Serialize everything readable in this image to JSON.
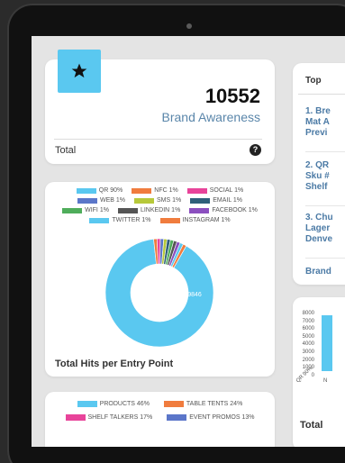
{
  "brand": {
    "value": "10552",
    "label": "Brand Awareness",
    "total_label": "Total",
    "help_glyph": "?",
    "accent": "#5ac8f0"
  },
  "entry_points": {
    "title": "Total Hits per Entry Point",
    "legend": [
      {
        "label": "QR 90%",
        "color": "#5ac8f0"
      },
      {
        "label": "NFC 1%",
        "color": "#f07c3e"
      },
      {
        "label": "SOCIAL 1%",
        "color": "#e8449a"
      },
      {
        "label": "WEB 1%",
        "color": "#5b76c9"
      },
      {
        "label": "SMS 1%",
        "color": "#b7c93a"
      },
      {
        "label": "EMAIL 1%",
        "color": "#2f5f7a"
      },
      {
        "label": "WIFI 1%",
        "color": "#4fad5b"
      },
      {
        "label": "LINKEDIN 1%",
        "color": "#555555"
      },
      {
        "label": "FACEBOOK 1%",
        "color": "#8b4fbf"
      },
      {
        "label": "TWITTER 1%",
        "color": "#5ac8f0"
      },
      {
        "label": "INSTAGRAM 1%",
        "color": "#f07c3e"
      }
    ],
    "slice_label": "9846"
  },
  "chart_data": {
    "type": "pie",
    "title": "Total Hits per Entry Point",
    "categories": [
      "QR",
      "NFC",
      "SOCIAL",
      "WEB",
      "SMS",
      "EMAIL",
      "WIFI",
      "LINKEDIN",
      "FACEBOOK",
      "TWITTER",
      "INSTAGRAM"
    ],
    "values": [
      90,
      1,
      1,
      1,
      1,
      1,
      1,
      1,
      1,
      1,
      1
    ],
    "colors": [
      "#5ac8f0",
      "#f07c3e",
      "#e8449a",
      "#5b76c9",
      "#b7c93a",
      "#2f5f7a",
      "#4fad5b",
      "#555555",
      "#8b4fbf",
      "#5ac8f0",
      "#f07c3e"
    ]
  },
  "placements": {
    "legend": [
      {
        "label": "PRODUCTS 46%",
        "color": "#5ac8f0"
      },
      {
        "label": "TABLE TENTS 24%",
        "color": "#f07c3e"
      },
      {
        "label": "SHELF TALKERS 17%",
        "color": "#e8449a"
      },
      {
        "label": "EVENT PROMOS 13%",
        "color": "#5b76c9"
      }
    ]
  },
  "top_list": {
    "heading": "Top",
    "items": [
      [
        "1. Bre",
        "Mat A",
        "Previ"
      ],
      [
        "2. QR",
        "Sku #",
        "Shelf"
      ],
      [
        "3. Chu",
        "Lager",
        "Denve"
      ]
    ],
    "footer": "Brand"
  },
  "bar_chart": {
    "y_ticks": [
      "8000",
      "7000",
      "6000",
      "5000",
      "4000",
      "3000",
      "2000",
      "1000",
      "0"
    ],
    "x_tick_1": "QR 90%",
    "x_tick_2": "N",
    "total_label": "Total"
  }
}
